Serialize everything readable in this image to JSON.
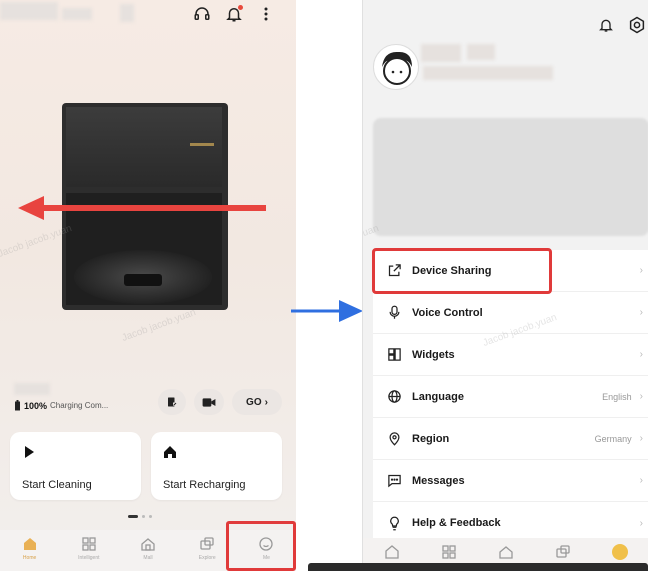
{
  "left_screen": {
    "battery_percent": "100%",
    "battery_state": "Charging Com...",
    "go_button_label": "GO",
    "cards": [
      {
        "label": "Start Cleaning",
        "icon": "play-icon"
      },
      {
        "label": "Start Recharging",
        "icon": "home-icon"
      }
    ],
    "tabs": [
      {
        "label": "Home",
        "icon": "home-icon",
        "active": true
      },
      {
        "label": "Intelligent",
        "icon": "grid-icon",
        "active": false
      },
      {
        "label": "Mall",
        "icon": "bag-icon",
        "active": false
      },
      {
        "label": "Explore",
        "icon": "explore-icon",
        "active": false
      },
      {
        "label": "Me",
        "icon": "me-icon",
        "active": false
      }
    ]
  },
  "right_screen": {
    "menu": [
      {
        "label": "Device Sharing",
        "icon": "share-icon",
        "value": ""
      },
      {
        "label": "Voice Control",
        "icon": "mic-icon",
        "value": ""
      },
      {
        "label": "Widgets",
        "icon": "widgets-icon",
        "value": ""
      },
      {
        "label": "Language",
        "icon": "globe-icon",
        "value": "English"
      },
      {
        "label": "Region",
        "icon": "location-pin-icon",
        "value": "Germany"
      },
      {
        "label": "Messages",
        "icon": "message-icon",
        "value": ""
      },
      {
        "label": "Help & Feedback",
        "icon": "lightbulb-icon",
        "value": ""
      }
    ]
  },
  "watermark": "Jacob jacob.yuan",
  "colors": {
    "highlight_red": "#e03a3a",
    "arrow_red": "#e8443f",
    "arrow_blue": "#2f6fe0",
    "accent_gold": "#d7a14a"
  }
}
